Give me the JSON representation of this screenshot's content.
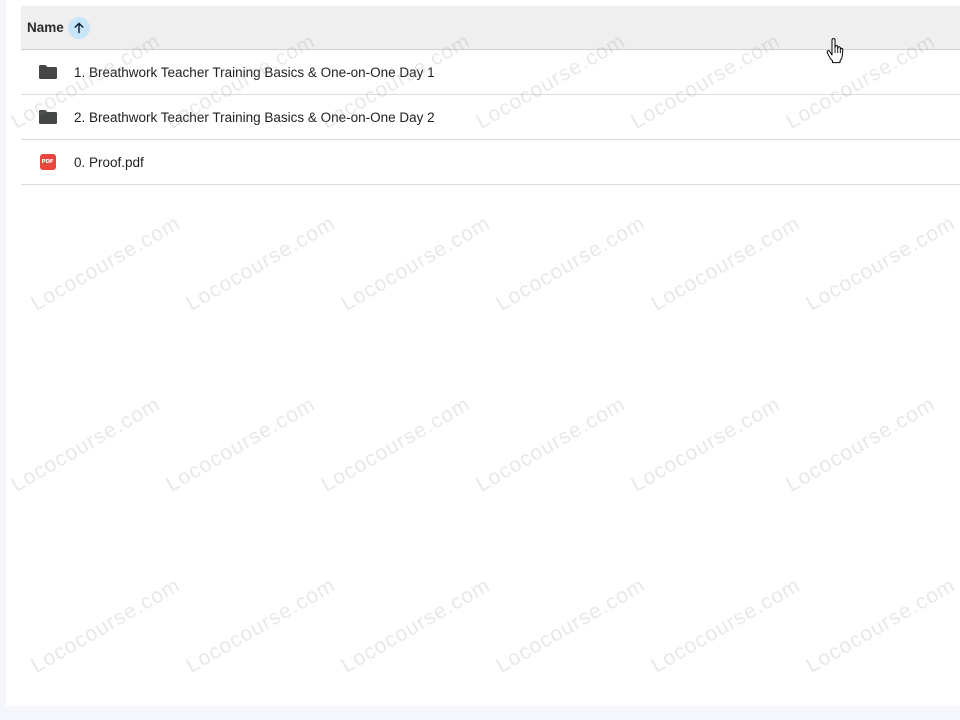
{
  "header": {
    "name_label": "Name",
    "sort_icon": "arrow-up-icon"
  },
  "rows": [
    {
      "label": "1. Breathwork Teacher Training Basics & One-on-One Day 1",
      "icon": "folder-icon"
    },
    {
      "label": "2. Breathwork Teacher Training Basics & One-on-One Day 2",
      "icon": "folder-icon"
    },
    {
      "label": "0. Proof.pdf",
      "icon": "pdf-icon",
      "badge": "PDF"
    }
  ],
  "watermark": {
    "text": "Lococourse.com"
  },
  "colors": {
    "header_bg": "#efefef",
    "sort_accent": "#c7e4f9",
    "folder": "#444746",
    "pdf": "#e8453c"
  }
}
